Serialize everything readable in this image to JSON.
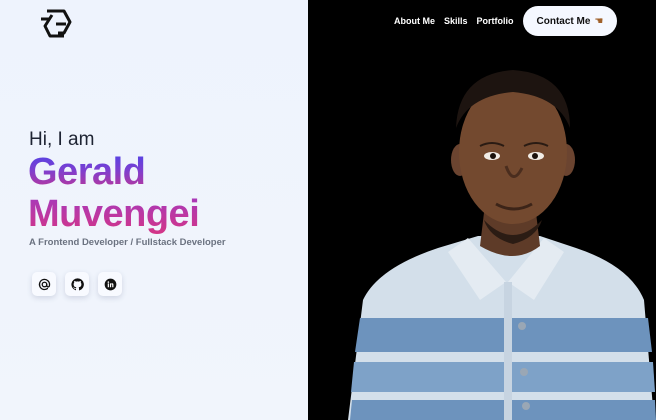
{
  "brand": {
    "logo_icon": "gc-monogram-logo"
  },
  "nav": {
    "links": [
      "About Me",
      "Skills",
      "Portfolio"
    ],
    "contact_label": "Contact Me",
    "contact_icon": "pointing-hand-icon"
  },
  "hero": {
    "greeting": "Hi, I am",
    "first_name": "Gerald",
    "last_name": "Muvengei",
    "subtitle": "A Frontend Developer / Fullstack Developer"
  },
  "socials": [
    {
      "icon": "email-at-icon"
    },
    {
      "icon": "github-icon"
    },
    {
      "icon": "linkedin-icon"
    }
  ],
  "colors": {
    "left_background": "#eef3fd",
    "right_background": "#000000",
    "name_gradient_start": "#4d44e8",
    "name_gradient_end": "#d53585",
    "contact_button_bg": "#f5f8ff"
  }
}
